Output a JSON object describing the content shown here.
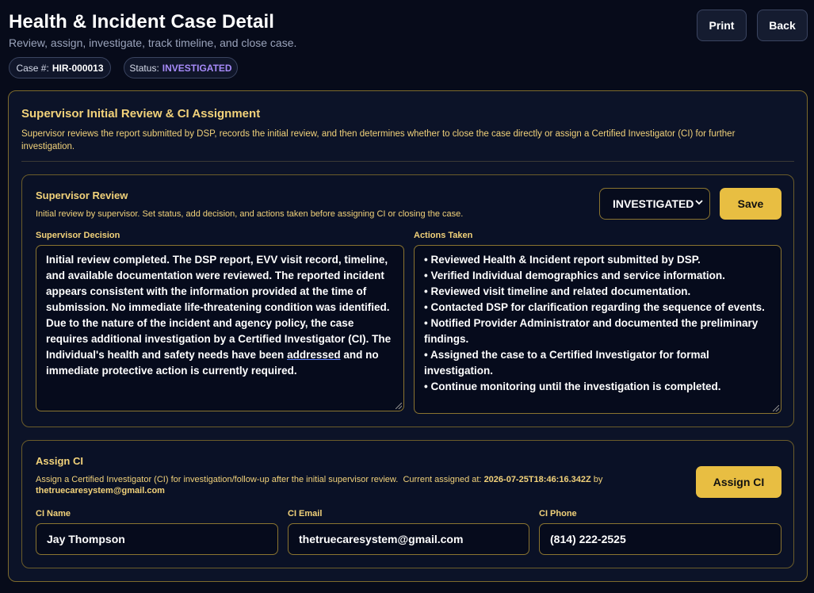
{
  "header": {
    "title": "Health & Incident Case Detail",
    "subtitle": "Review, assign, investigate, track timeline, and close case.",
    "print_label": "Print",
    "back_label": "Back",
    "case_label": "Case #:",
    "case_number": "HIR-000013",
    "status_label": "Status:",
    "status_value": "INVESTIGATED"
  },
  "section": {
    "title": "Supervisor Initial Review & CI Assignment",
    "description": "Supervisor reviews the report submitted by DSP, records the initial review, and then determines whether to close the case directly or assign a Certified Investigator (CI) for further investigation."
  },
  "review": {
    "title": "Supervisor Review",
    "description": "Initial review by supervisor. Set status, add decision, and actions taken before assigning CI or closing the case.",
    "status_selected": "INVESTIGATED",
    "save_label": "Save",
    "decision_label": "Supervisor Decision",
    "decision_text_before": "Initial review completed. The DSP report, EVV visit record, timeline, and available documentation were reviewed. The reported incident appears consistent with the information provided at the time of submission. No immediate life-threatening condition was identified. Due to the nature of the incident and agency policy, the case requires additional investigation by a Certified Investigator (CI). The Individual's health and safety needs have been ",
    "decision_text_underlined": "addressed",
    "decision_text_after": " and no immediate protective action is currently required.",
    "actions_label": "Actions Taken",
    "actions": [
      "• Reviewed Health & Incident report submitted by DSP.",
      "• Verified Individual demographics and service information.",
      "• Reviewed visit timeline and related documentation.",
      "• Contacted DSP for clarification regarding the sequence of events.",
      "• Notified Provider Administrator and documented the preliminary findings.",
      "• Assigned the case to a Certified Investigator for formal investigation.",
      "• Continue monitoring until the investigation is completed."
    ]
  },
  "assign": {
    "title": "Assign CI",
    "description": "Assign a Certified Investigator (CI) for investigation/follow-up after the initial supervisor review.",
    "current_assigned_label": "Current assigned at:",
    "current_assigned_at": "2026-07-25T18:46:16.342Z",
    "by_label": "by",
    "assigned_by": "thetruecaresystem@gmail.com",
    "assign_button_label": "Assign CI",
    "ci_name_label": "CI Name",
    "ci_name": "Jay Thompson",
    "ci_email_label": "CI Email",
    "ci_email": "thetruecaresystem@gmail.com",
    "ci_phone_label": "CI Phone",
    "ci_phone": "(814) 222-2525"
  }
}
